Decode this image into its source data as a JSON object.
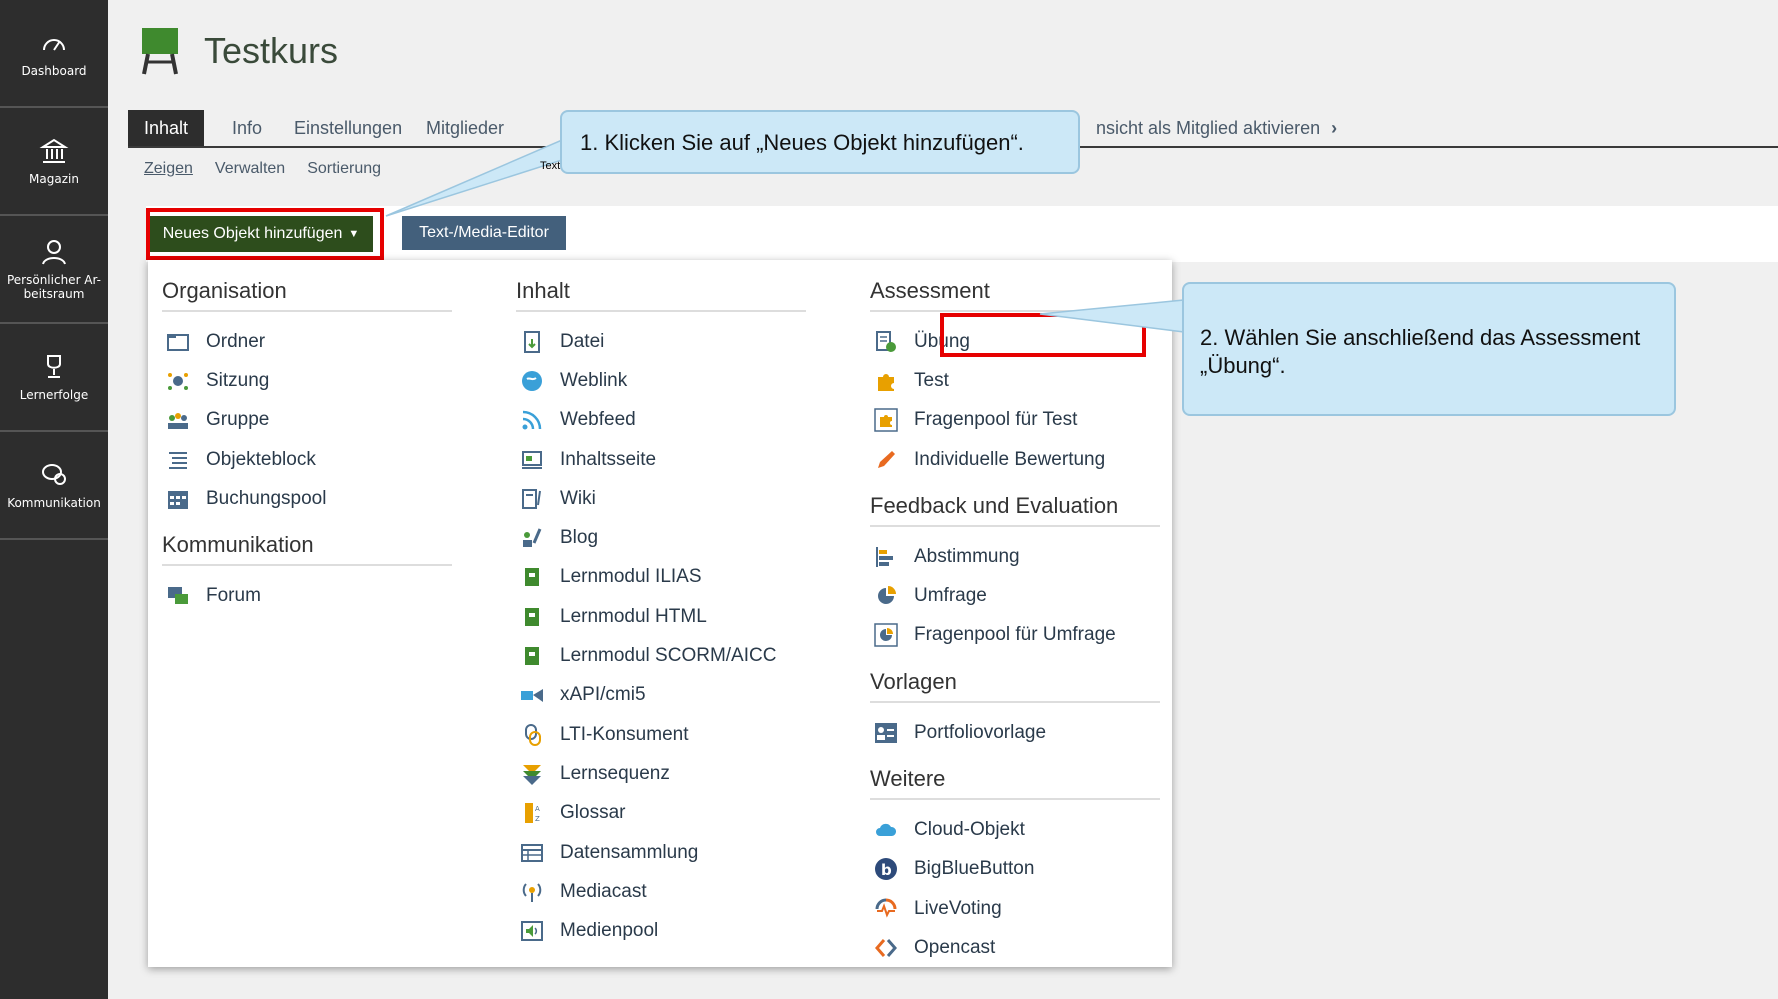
{
  "sidebar": {
    "items": [
      {
        "label": "Dashboard",
        "icon": "dashboard-icon"
      },
      {
        "label": "Magazin",
        "icon": "bank-icon"
      },
      {
        "label": "Persönlicher Ar-beitsraum",
        "icon": "user-icon"
      },
      {
        "label": "Lernerfolge",
        "icon": "trophy-icon"
      },
      {
        "label": "Kommunikation",
        "icon": "chat-icon"
      }
    ]
  },
  "header": {
    "title": "Testkurs"
  },
  "tabs": [
    {
      "label": "Inhalt"
    },
    {
      "label": "Info"
    },
    {
      "label": "Einstellungen"
    },
    {
      "label": "Mitglieder"
    },
    {
      "label": "nsicht als Mitglied aktivieren"
    }
  ],
  "subtabs": [
    {
      "label": "Zeigen"
    },
    {
      "label": "Verwalten"
    },
    {
      "label": "Sortierung"
    }
  ],
  "toolbar": {
    "add_label": "Neues Objekt hinzufügen",
    "editor_label": "Text-/Media-Editor"
  },
  "menu": {
    "organisation": {
      "heading": "Organisation",
      "items": [
        "Ordner",
        "Sitzung",
        "Gruppe",
        "Objekteblock",
        "Buchungspool"
      ]
    },
    "kommunikation": {
      "heading": "Kommunikation",
      "items": [
        "Forum"
      ]
    },
    "inhalt": {
      "heading": "Inhalt",
      "items": [
        "Datei",
        "Weblink",
        "Webfeed",
        "Inhaltsseite",
        "Wiki",
        "Blog",
        "Lernmodul ILIAS",
        "Lernmodul HTML",
        "Lernmodul SCORM/AICC",
        "xAPI/cmi5",
        "LTI-Konsument",
        "Lernsequenz",
        "Glossar",
        "Datensammlung",
        "Mediacast",
        "Medienpool"
      ]
    },
    "assessment": {
      "heading": "Assessment",
      "items": [
        "Übung",
        "Test",
        "Fragenpool für Test",
        "Individuelle Bewertung"
      ]
    },
    "feedback": {
      "heading": "Feedback und Evaluation",
      "items": [
        "Abstimmung",
        "Umfrage",
        "Fragenpool für Umfrage"
      ]
    },
    "vorlagen": {
      "heading": "Vorlagen",
      "items": [
        "Portfoliovorlage"
      ]
    },
    "weitere": {
      "heading": "Weitere",
      "items": [
        "Cloud-Objekt",
        "BigBlueButton",
        "LiveVoting",
        "Opencast"
      ]
    }
  },
  "callouts": {
    "step1": "1. Klicken Sie auf „Neues Objekt hinzufügen“.",
    "step2": "2. Wählen Sie anschließend das Assessment „Übung“.",
    "tiny": "Text"
  },
  "colors": {
    "sidebar": "#2d2d2d",
    "add_button": "#2d4d1c",
    "editor_button": "#43607c",
    "highlight": "#e60000",
    "callout": "#cce8f7"
  }
}
